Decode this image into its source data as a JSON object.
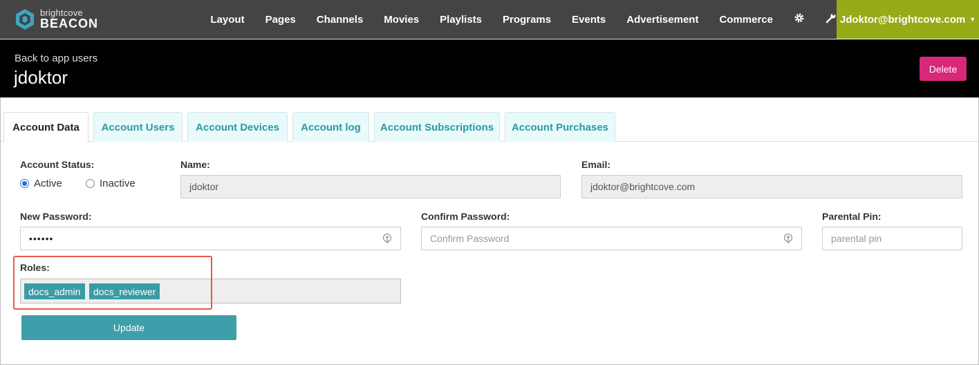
{
  "brand": {
    "small": "brightcove",
    "big": "BEACON"
  },
  "nav": {
    "items": [
      "Layout",
      "Pages",
      "Channels",
      "Movies",
      "Playlists",
      "Programs",
      "Events",
      "Advertisement",
      "Commerce"
    ],
    "user": "Jdoktor@brightcove.com"
  },
  "header": {
    "back_label": "Back to app users",
    "title": "jdoktor",
    "delete_label": "Delete"
  },
  "tabs": [
    "Account Data",
    "Account Users",
    "Account Devices",
    "Account log",
    "Account Subscriptions",
    "Account Purchases"
  ],
  "form": {
    "status_label": "Account Status:",
    "status_options": [
      "Active",
      "Inactive"
    ],
    "name_label": "Name:",
    "name_value": "jdoktor",
    "email_label": "Email:",
    "email_value": "jdoktor@brightcove.com",
    "new_password_label": "New Password:",
    "new_password_value": "••••••",
    "confirm_password_label": "Confirm Password:",
    "confirm_password_placeholder": "Confirm Password",
    "pin_label": "Parental Pin:",
    "pin_placeholder": "parental pin",
    "roles_label": "Roles:",
    "roles": [
      "docs_admin",
      "docs_reviewer"
    ],
    "update_label": "Update"
  },
  "colors": {
    "accent": "#3e9ea9",
    "user_menu": "#97aa17",
    "delete": "#d8287a",
    "highlight": "#e8574a"
  }
}
